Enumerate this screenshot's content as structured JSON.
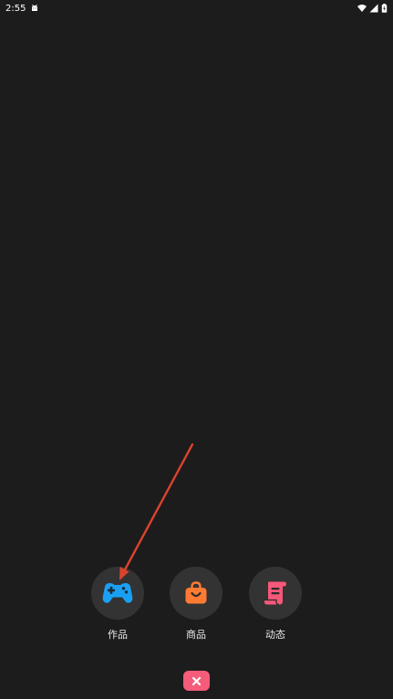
{
  "status_bar": {
    "time": "2:55",
    "icons": [
      "android-icon",
      "wifi-icon",
      "signal-icon",
      "battery-charging-icon"
    ]
  },
  "actions": [
    {
      "label": "作品",
      "icon": "gamepad-icon",
      "color": "#1aa0f2"
    },
    {
      "label": "商品",
      "icon": "shopping-bag-icon",
      "color": "#ff7a33"
    },
    {
      "label": "动态",
      "icon": "scroll-icon",
      "color": "#f6587a"
    }
  ],
  "close_button": {
    "icon": "close-icon",
    "color": "#f65c7a"
  },
  "colors": {
    "background": "#1c1c1c",
    "circle": "#333333",
    "annotation_arrow": "#d9432e"
  }
}
